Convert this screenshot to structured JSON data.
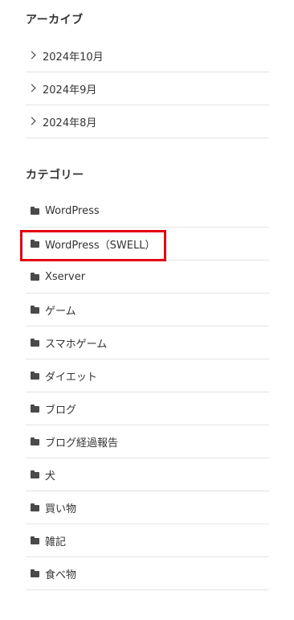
{
  "archive": {
    "title": "アーカイブ",
    "items": [
      {
        "label": "2024年10月"
      },
      {
        "label": "2024年9月"
      },
      {
        "label": "2024年8月"
      }
    ]
  },
  "category": {
    "title": "カテゴリー",
    "items": [
      {
        "label": "WordPress"
      },
      {
        "label": "WordPress（SWELL）",
        "highlighted": true
      },
      {
        "label": "Xserver"
      },
      {
        "label": "ゲーム"
      },
      {
        "label": "スマホゲーム"
      },
      {
        "label": "ダイエット"
      },
      {
        "label": "ブログ"
      },
      {
        "label": "ブログ経過報告"
      },
      {
        "label": "犬"
      },
      {
        "label": "買い物"
      },
      {
        "label": "雑記"
      },
      {
        "label": "食べ物"
      }
    ]
  },
  "icons": {
    "archive_item_icon": "chevron-right-icon",
    "category_item_icon": "folder-icon"
  },
  "colors": {
    "highlight_border": "#e60012",
    "text": "#333333",
    "divider": "#e3e3e3"
  }
}
